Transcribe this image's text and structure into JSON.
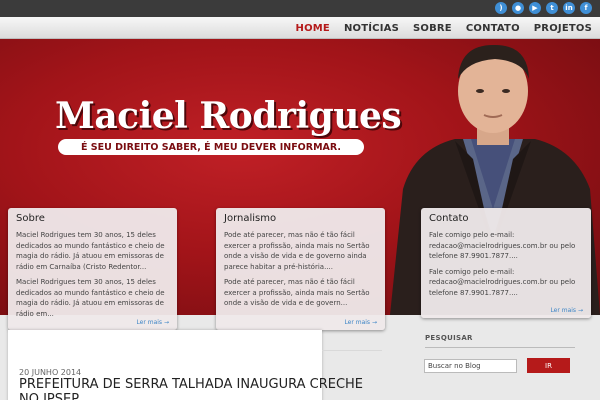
{
  "social": [
    {
      "icon": "rss-icon",
      "glyph": ")"
    },
    {
      "icon": "flickr-icon",
      "glyph": "●"
    },
    {
      "icon": "youtube-icon",
      "glyph": "▶"
    },
    {
      "icon": "twitter-icon",
      "glyph": "t"
    },
    {
      "icon": "linkedin-icon",
      "glyph": "in"
    },
    {
      "icon": "facebook-icon",
      "glyph": "f"
    }
  ],
  "nav": {
    "items": [
      {
        "label": "HOME"
      },
      {
        "label": "NOTÍCIAS"
      },
      {
        "label": "SOBRE"
      },
      {
        "label": "CONTATO"
      },
      {
        "label": "PROJETOS"
      }
    ],
    "active": "HOME"
  },
  "hero": {
    "title": "Maciel Rodrigues",
    "tagline": "É SEU DIREITO SABER, É MEU DEVER INFORMAR."
  },
  "boxes": [
    {
      "title": "Sobre",
      "paragraphs": [
        "Maciel Rodrigues tem 30 anos, 15 deles dedicados ao mundo fantástico e cheio de magia do rádio. Já atuou em emissoras de rádio em Carnaíba (Cristo Redentor...",
        "Maciel Rodrigues tem 30 anos, 15 deles dedicados ao mundo fantástico e cheio de magia do rádio. Já atuou em emissoras de rádio em..."
      ],
      "more": "Ler mais →"
    },
    {
      "title": "Jornalismo",
      "paragraphs": [
        "Pode até parecer, mas não é tão fácil exercer a profissão, ainda mais no Sertão onde a visão de vida e de governo ainda parece habitar a pré-história....",
        "Pode até parecer, mas não é tão fácil exercer a profissão, ainda mais no Sertão onde a visão de vida e de govern..."
      ],
      "more": "Ler mais →"
    },
    {
      "title": "Contato",
      "paragraphs": [
        "Fale comigo pelo e-mail: redacao@macielrodrigues.com.br ou pelo telefone 87.9901.7877....",
        "Fale comigo pelo e-mail: redacao@macielrodrigues.com.br ou pelo telefone 87.9901.7877...."
      ],
      "more": "Ler mais →"
    }
  ],
  "post": {
    "date": "20 JUNHO 2014",
    "title": "PREFEITURA DE SERRA TALHADA INAUGURA CRECHE NO IPSEP"
  },
  "sidebar": {
    "title": "PESQUISAR",
    "search_placeholder": "Buscar no Blog",
    "button": "IR"
  },
  "colors": {
    "accent": "#b51a1a",
    "link": "#3d85c6",
    "hero_red": "#a21419"
  }
}
